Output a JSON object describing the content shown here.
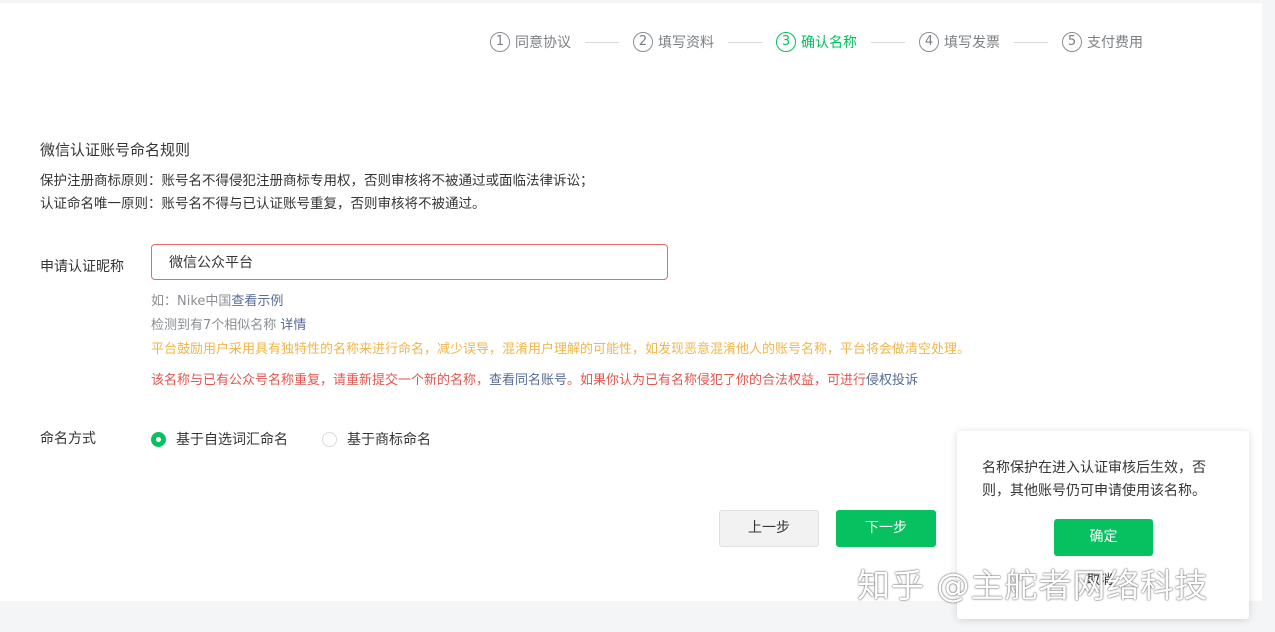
{
  "steps": [
    {
      "num": "1",
      "label": "同意协议"
    },
    {
      "num": "2",
      "label": "填写资料"
    },
    {
      "num": "3",
      "label": "确认名称"
    },
    {
      "num": "4",
      "label": "填写发票"
    },
    {
      "num": "5",
      "label": "支付费用"
    }
  ],
  "active_step": 3,
  "rules": {
    "title": "微信认证账号命名规则",
    "line1": "保护注册商标原则：账号名不得侵犯注册商标专用权，否则审核将不被通过或面临法律诉讼；",
    "line2": "认证命名唯一原则：账号名不得与已认证账号重复，否则审核将不被通过。"
  },
  "nickname": {
    "label": "申请认证昵称",
    "value": "微信公众平台"
  },
  "tips": {
    "example_prefix": "如：Nike中国",
    "example_link": "查看示例",
    "similar_prefix": "检测到有7个相似名称",
    "similar_link": "详情",
    "encourage": "平台鼓励用户采用具有独特性的名称来进行命名，减少误导，混淆用户理解的可能性，如发现恶意混淆他人的账号名称，平台将会做清空处理。",
    "dup_prefix": "该名称与已有公众号名称重复，请重新提交一个新的名称，",
    "dup_link": "查看同名账号",
    "dup_middle": "。如果你认为已有名称侵犯了你的合法权益，可进行",
    "dup_complaint": "侵权投诉"
  },
  "naming": {
    "label": "命名方式",
    "option1": "基于自选词汇命名",
    "option2": "基于商标命名",
    "selected": "基于自选词汇命名"
  },
  "buttons": {
    "prev": "上一步",
    "next": "下一步"
  },
  "popover": {
    "text": "名称保护在进入认证审核后生效，否则，其他账号仍可申请使用该名称。",
    "confirm": "确定",
    "cancel": "取消"
  },
  "watermark": "知乎 @主舵者网络科技",
  "colors": {
    "accent": "#07c160",
    "error": "#e3574f",
    "warning": "#f0b64b",
    "link": "#576b95"
  }
}
